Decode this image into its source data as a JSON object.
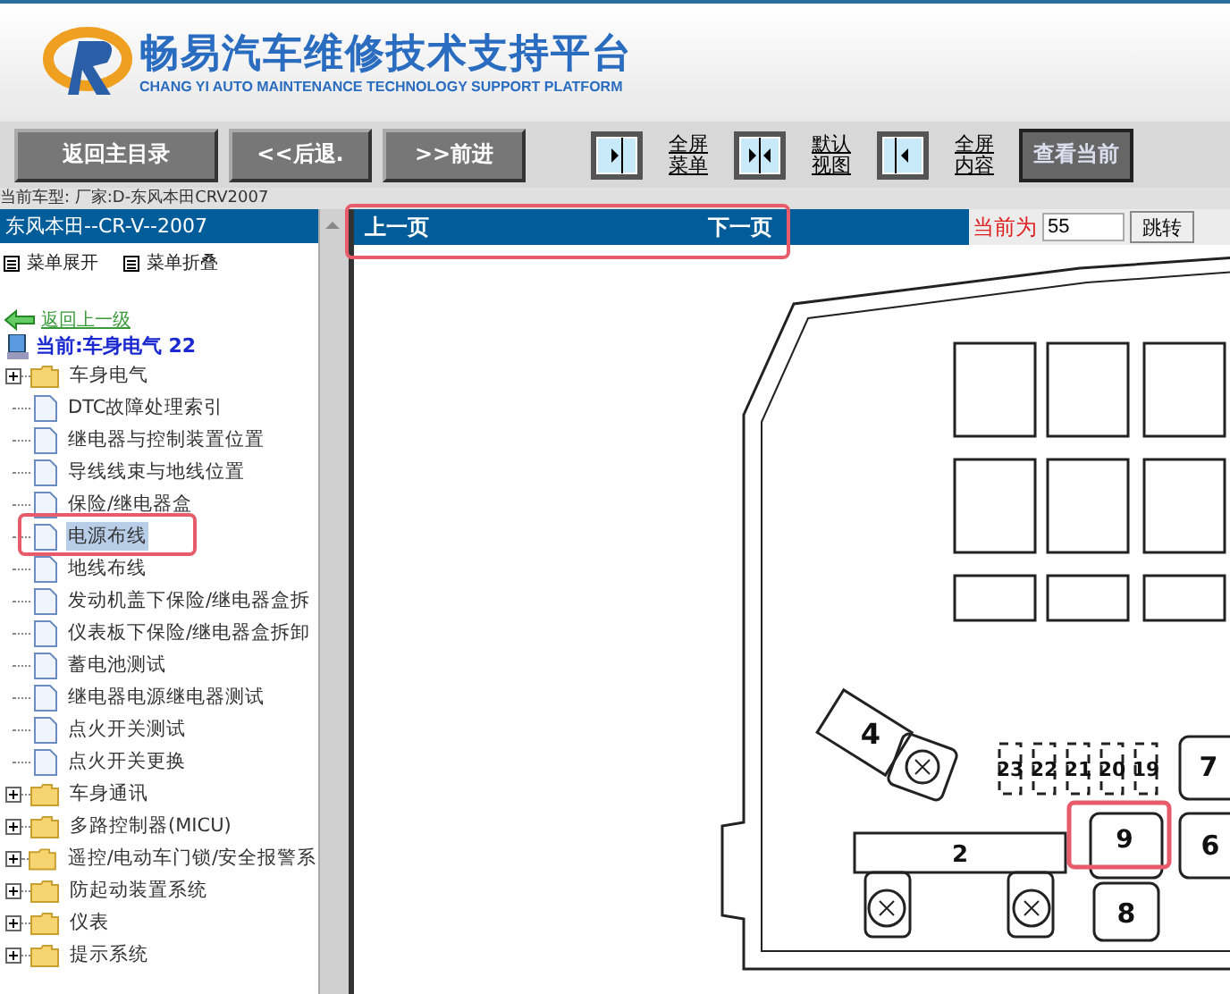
{
  "header": {
    "title": "畅易汽车维修技术支持平台",
    "subtitle": "CHANG YI AUTO MAINTENANCE TECHNOLOGY SUPPORT PLATFORM"
  },
  "toolbar": {
    "buttons": [
      "返回主目录",
      "<<后退.",
      ">>前进"
    ],
    "view_buttons": [
      {
        "kind": "menu",
        "label": [
          "全屏",
          "菜单"
        ]
      },
      {
        "kind": "default",
        "label": [
          "默认",
          "视图"
        ]
      },
      {
        "kind": "content",
        "label": [
          "全屏",
          "内容"
        ]
      }
    ],
    "view_current": "查看当前"
  },
  "vehicle_info": "当前车型:  厂家:D-东风本田CRV2007",
  "sidebar": {
    "title": "东风本田--CR-V--2007",
    "expand": "菜单展开",
    "collapse": "菜单折叠",
    "back": "返回上一级",
    "current": "当前:车身电气 22",
    "items": [
      {
        "kind": "folder",
        "label": "车身电气",
        "selected": false
      },
      {
        "kind": "page",
        "label": "DTC故障处理索引",
        "selected": false
      },
      {
        "kind": "page",
        "label": "继电器与控制装置位置",
        "selected": false
      },
      {
        "kind": "page",
        "label": "导线线束与地线位置",
        "selected": false
      },
      {
        "kind": "page",
        "label": "保险/继电器盒",
        "selected": false
      },
      {
        "kind": "page",
        "label": "电源布线",
        "selected": true
      },
      {
        "kind": "page",
        "label": "地线布线",
        "selected": false
      },
      {
        "kind": "page",
        "label": "发动机盖下保险/继电器盒拆",
        "selected": false
      },
      {
        "kind": "page",
        "label": "仪表板下保险/继电器盒拆卸",
        "selected": false
      },
      {
        "kind": "page",
        "label": "蓄电池测试",
        "selected": false
      },
      {
        "kind": "page",
        "label": "继电器电源继电器测试",
        "selected": false
      },
      {
        "kind": "page",
        "label": "点火开关测试",
        "selected": false
      },
      {
        "kind": "page",
        "label": "点火开关更换",
        "selected": false
      },
      {
        "kind": "folder",
        "label": "车身通讯",
        "selected": false
      },
      {
        "kind": "folder",
        "label": "多路控制器(MICU)",
        "selected": false
      },
      {
        "kind": "folder",
        "label": "遥控/电动车门锁/安全报警系",
        "selected": false
      },
      {
        "kind": "folder",
        "label": "防起动装置系统",
        "selected": false
      },
      {
        "kind": "folder",
        "label": "仪表",
        "selected": false
      },
      {
        "kind": "folder",
        "label": "提示系统",
        "selected": false
      }
    ]
  },
  "pager": {
    "prev": "上一页",
    "next": "下一页",
    "current_label": "当前为",
    "page": "55",
    "go": "跳转"
  },
  "diagram": {
    "labels": [
      "4",
      "23",
      "22",
      "21",
      "20",
      "19",
      "7",
      "2",
      "9",
      "6",
      "8"
    ]
  }
}
